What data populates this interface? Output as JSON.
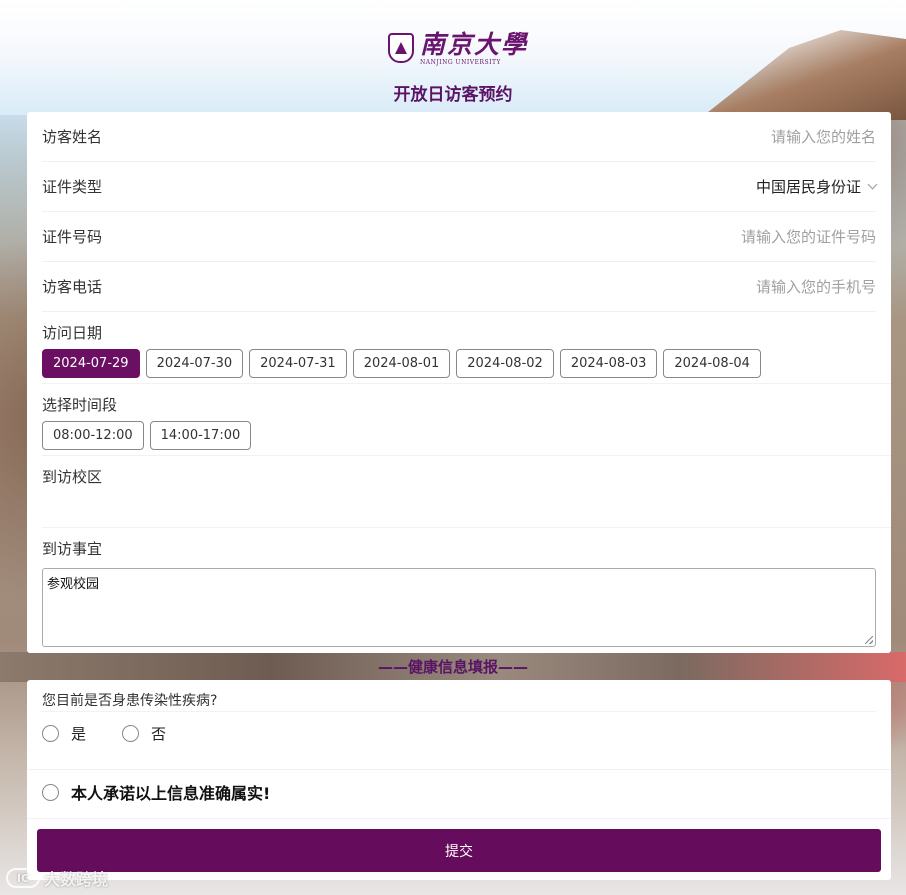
{
  "header": {
    "university_cn": "南京大學",
    "university_en": "NANJING UNIVERSITY",
    "title": "开放日访客预约"
  },
  "form": {
    "name": {
      "label": "访客姓名",
      "placeholder": "请输入您的姓名"
    },
    "id_type": {
      "label": "证件类型",
      "value": "中国居民身份证"
    },
    "id_number": {
      "label": "证件号码",
      "placeholder": "请输入您的证件号码"
    },
    "phone": {
      "label": "访客电话",
      "placeholder": "请输入您的手机号"
    },
    "visit_date": {
      "label": "访问日期",
      "options": [
        "2024-07-29",
        "2024-07-30",
        "2024-07-31",
        "2024-08-01",
        "2024-08-02",
        "2024-08-03",
        "2024-08-04"
      ],
      "selected": "2024-07-29"
    },
    "time_slot": {
      "label": "选择时间段",
      "options": [
        "08:00-12:00",
        "14:00-17:00"
      ]
    },
    "campus": {
      "label": "到访校区"
    },
    "purpose": {
      "label": "到访事宜",
      "value": "参观校园"
    }
  },
  "health": {
    "title": "——健康信息填报——",
    "question": "您目前是否身患传染性疾病?",
    "options": [
      "是",
      "否"
    ],
    "promise": "本人承诺以上信息准确属实!"
  },
  "submit_label": "提交",
  "watermark": {
    "logo": "IC",
    "text": "大数跨境"
  },
  "colors": {
    "brand": "#660c5c",
    "title": "#5a1466"
  }
}
